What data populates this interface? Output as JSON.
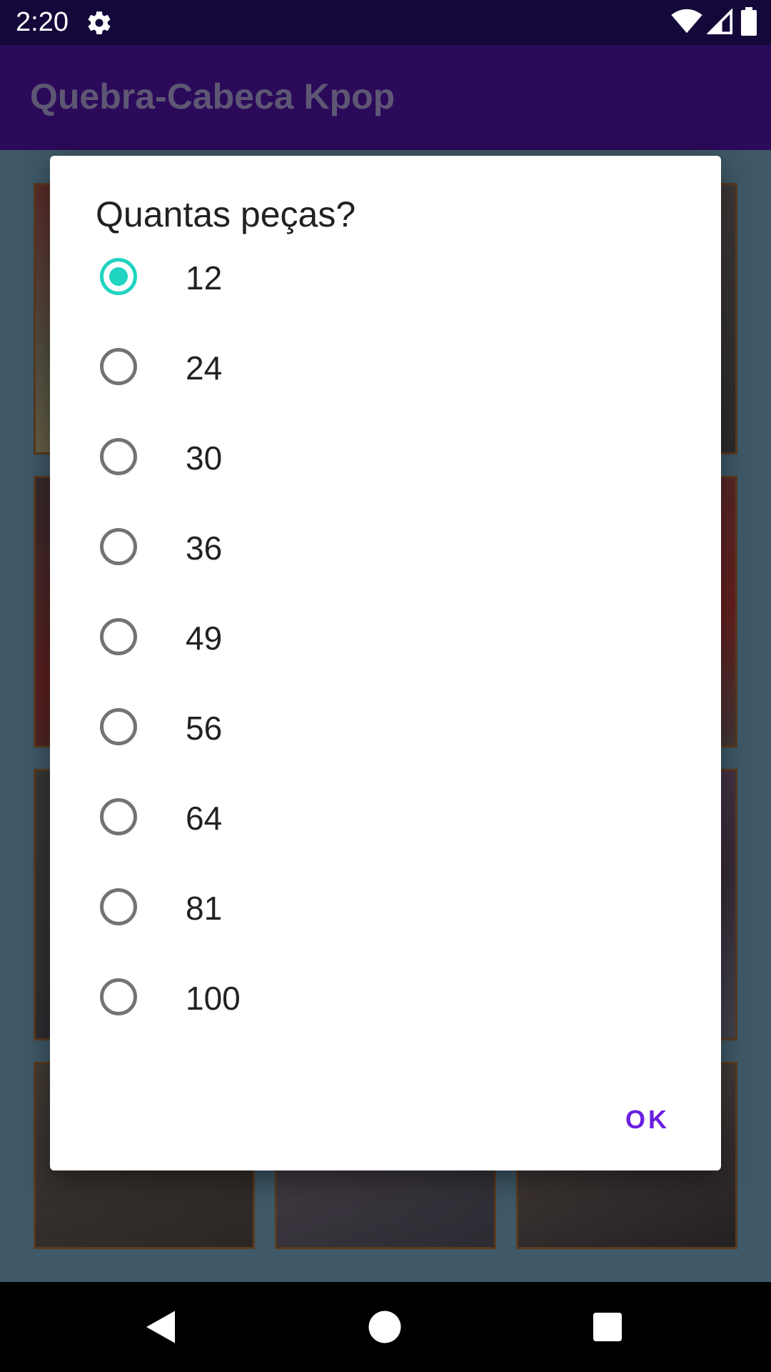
{
  "status_bar": {
    "time": "2:20",
    "icons": [
      "settings-icon",
      "wifi-icon",
      "signal-icon",
      "battery-icon"
    ]
  },
  "app_bar": {
    "title": "Quebra-Cabeca Kpop"
  },
  "dialog": {
    "title": "Quantas peças?",
    "selected": "12",
    "options": [
      {
        "label": "12",
        "checked": true
      },
      {
        "label": "24",
        "checked": false
      },
      {
        "label": "30",
        "checked": false
      },
      {
        "label": "36",
        "checked": false
      },
      {
        "label": "49",
        "checked": false
      },
      {
        "label": "56",
        "checked": false
      },
      {
        "label": "64",
        "checked": false
      },
      {
        "label": "81",
        "checked": false
      },
      {
        "label": "100",
        "checked": false
      }
    ],
    "ok_label": "OK"
  },
  "nav_bar": {
    "icons": [
      "back-icon",
      "home-icon",
      "recents-icon"
    ]
  },
  "colors": {
    "status_bar": "#14083a",
    "app_bar": "#2b0a5a",
    "background": "#3f5968",
    "radio_checked": "#1fd4c0",
    "radio_unchecked": "#737373",
    "ok_text": "#6a1fe0"
  }
}
